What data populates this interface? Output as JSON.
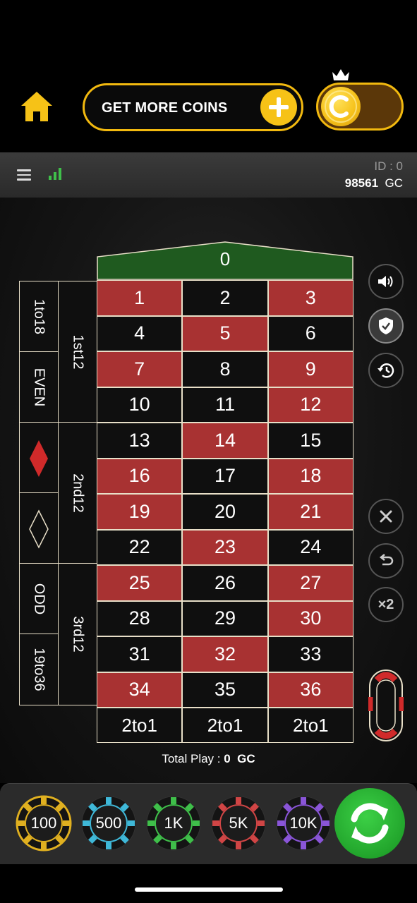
{
  "header": {
    "get_more_coins": "GET MORE COINS"
  },
  "infobar": {
    "id_label": "ID : 0",
    "balance_value": "98561",
    "balance_unit": "GC"
  },
  "table": {
    "zero": "0",
    "numbers": [
      {
        "n": "1",
        "c": "red"
      },
      {
        "n": "2",
        "c": "black"
      },
      {
        "n": "3",
        "c": "red"
      },
      {
        "n": "4",
        "c": "black"
      },
      {
        "n": "5",
        "c": "red"
      },
      {
        "n": "6",
        "c": "black"
      },
      {
        "n": "7",
        "c": "red"
      },
      {
        "n": "8",
        "c": "black"
      },
      {
        "n": "9",
        "c": "red"
      },
      {
        "n": "10",
        "c": "black"
      },
      {
        "n": "11",
        "c": "black"
      },
      {
        "n": "12",
        "c": "red"
      },
      {
        "n": "13",
        "c": "black"
      },
      {
        "n": "14",
        "c": "red"
      },
      {
        "n": "15",
        "c": "black"
      },
      {
        "n": "16",
        "c": "red"
      },
      {
        "n": "17",
        "c": "black"
      },
      {
        "n": "18",
        "c": "red"
      },
      {
        "n": "19",
        "c": "red"
      },
      {
        "n": "20",
        "c": "black"
      },
      {
        "n": "21",
        "c": "red"
      },
      {
        "n": "22",
        "c": "black"
      },
      {
        "n": "23",
        "c": "red"
      },
      {
        "n": "24",
        "c": "black"
      },
      {
        "n": "25",
        "c": "red"
      },
      {
        "n": "26",
        "c": "black"
      },
      {
        "n": "27",
        "c": "red"
      },
      {
        "n": "28",
        "c": "black"
      },
      {
        "n": "29",
        "c": "black"
      },
      {
        "n": "30",
        "c": "red"
      },
      {
        "n": "31",
        "c": "black"
      },
      {
        "n": "32",
        "c": "red"
      },
      {
        "n": "33",
        "c": "black"
      },
      {
        "n": "34",
        "c": "red"
      },
      {
        "n": "35",
        "c": "black"
      },
      {
        "n": "36",
        "c": "red"
      }
    ],
    "columns": [
      "2to1",
      "2to1",
      "2to1"
    ],
    "dozens": [
      "1st12",
      "2nd12",
      "3rd12"
    ],
    "outside": [
      "1to18",
      "EVEN",
      "RED",
      "BLACK",
      "ODD",
      "19to36"
    ]
  },
  "controls": {
    "double_label": "×2"
  },
  "total": {
    "label": "Total Play : ",
    "value": "0",
    "unit": "GC"
  },
  "chips": [
    {
      "label": "100",
      "color": "#e0b020",
      "selected": true
    },
    {
      "label": "500",
      "color": "#3fb8d8",
      "selected": false
    },
    {
      "label": "1K",
      "color": "#3fbf4a",
      "selected": false
    },
    {
      "label": "5K",
      "color": "#d04545",
      "selected": false
    },
    {
      "label": "10K",
      "color": "#8a55d8",
      "selected": false
    }
  ],
  "colors": {
    "accent": "#f2b90f",
    "red_cell": "#a83232",
    "black_cell": "#0f0f0f",
    "zero_green": "#1f5a1f",
    "spin_green": "#22a52c"
  }
}
